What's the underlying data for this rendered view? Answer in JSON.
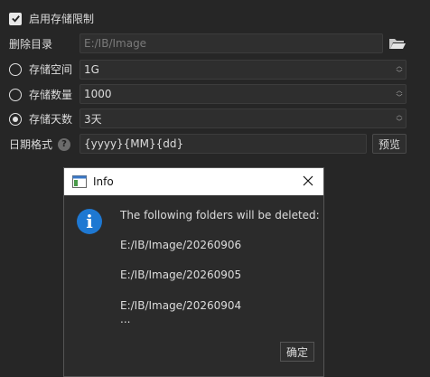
{
  "settings": {
    "enable_limit_label": "启用存储限制",
    "delete_dir_label": "删除目录",
    "delete_dir_value": "E:/IB/Image",
    "space_label": "存储空间",
    "space_value": "1G",
    "count_label": "存储数量",
    "count_value": "1000",
    "days_label": "存储天数",
    "days_value": "3天",
    "date_format_label": "日期格式",
    "date_format_value": "{yyyy}{MM}{dd}",
    "preview_label": "预览",
    "help_glyph": "?"
  },
  "dialog": {
    "title": "Info",
    "message": "The following folders will be deleted:",
    "folders": [
      "E:/IB/Image/20260906",
      "E:/IB/Image/20260905",
      "E:/IB/Image/20260904"
    ],
    "ellipsis": "...",
    "ok_label": "确定",
    "info_glyph": "i"
  },
  "colors": {
    "background": "#262626",
    "accent": "#1e78d2"
  }
}
